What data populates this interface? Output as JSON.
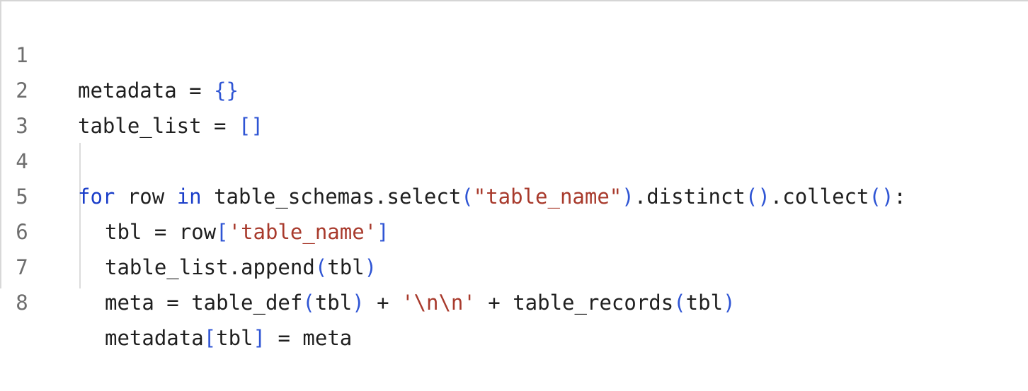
{
  "editor": {
    "line_numbers": [
      "1",
      "2",
      "3",
      "4",
      "5",
      "6",
      "7",
      "8"
    ],
    "lines": [
      [
        {
          "t": "metadata = ",
          "c": "plain"
        },
        {
          "t": "{}",
          "c": "br"
        }
      ],
      [
        {
          "t": "table_list = ",
          "c": "plain"
        },
        {
          "t": "[]",
          "c": "br"
        }
      ],
      [],
      [
        {
          "t": "for",
          "c": "kw"
        },
        {
          "t": " row ",
          "c": "plain"
        },
        {
          "t": "in",
          "c": "kw"
        },
        {
          "t": " table_schemas.select",
          "c": "plain"
        },
        {
          "t": "(",
          "c": "br"
        },
        {
          "t": "\"table_name\"",
          "c": "str"
        },
        {
          "t": ")",
          "c": "br"
        },
        {
          "t": ".distinct",
          "c": "plain"
        },
        {
          "t": "()",
          "c": "br"
        },
        {
          "t": ".collect",
          "c": "plain"
        },
        {
          "t": "()",
          "c": "br"
        },
        {
          "t": ":",
          "c": "plain"
        }
      ],
      [
        {
          "t": "tbl = row",
          "c": "plain"
        },
        {
          "t": "[",
          "c": "br"
        },
        {
          "t": "'table_name'",
          "c": "str"
        },
        {
          "t": "]",
          "c": "br"
        }
      ],
      [
        {
          "t": "table_list.append",
          "c": "plain"
        },
        {
          "t": "(",
          "c": "br"
        },
        {
          "t": "tbl",
          "c": "plain"
        },
        {
          "t": ")",
          "c": "br"
        }
      ],
      [
        {
          "t": "meta = table_def",
          "c": "plain"
        },
        {
          "t": "(",
          "c": "br"
        },
        {
          "t": "tbl",
          "c": "plain"
        },
        {
          "t": ")",
          "c": "br"
        },
        {
          "t": " + ",
          "c": "plain"
        },
        {
          "t": "'\\n\\n'",
          "c": "str"
        },
        {
          "t": " + table_records",
          "c": "plain"
        },
        {
          "t": "(",
          "c": "br"
        },
        {
          "t": "tbl",
          "c": "plain"
        },
        {
          "t": ")",
          "c": "br"
        }
      ],
      [
        {
          "t": "metadata",
          "c": "plain"
        },
        {
          "t": "[",
          "c": "br"
        },
        {
          "t": "tbl",
          "c": "plain"
        },
        {
          "t": "]",
          "c": "br"
        },
        {
          "t": " = meta",
          "c": "plain"
        }
      ]
    ],
    "colors": {
      "keyword": "#1b3ec9",
      "bracket": "#2f55d4",
      "string": "#a83a2c",
      "text": "#1f1f1f",
      "line_number": "#6e6e6e"
    }
  }
}
